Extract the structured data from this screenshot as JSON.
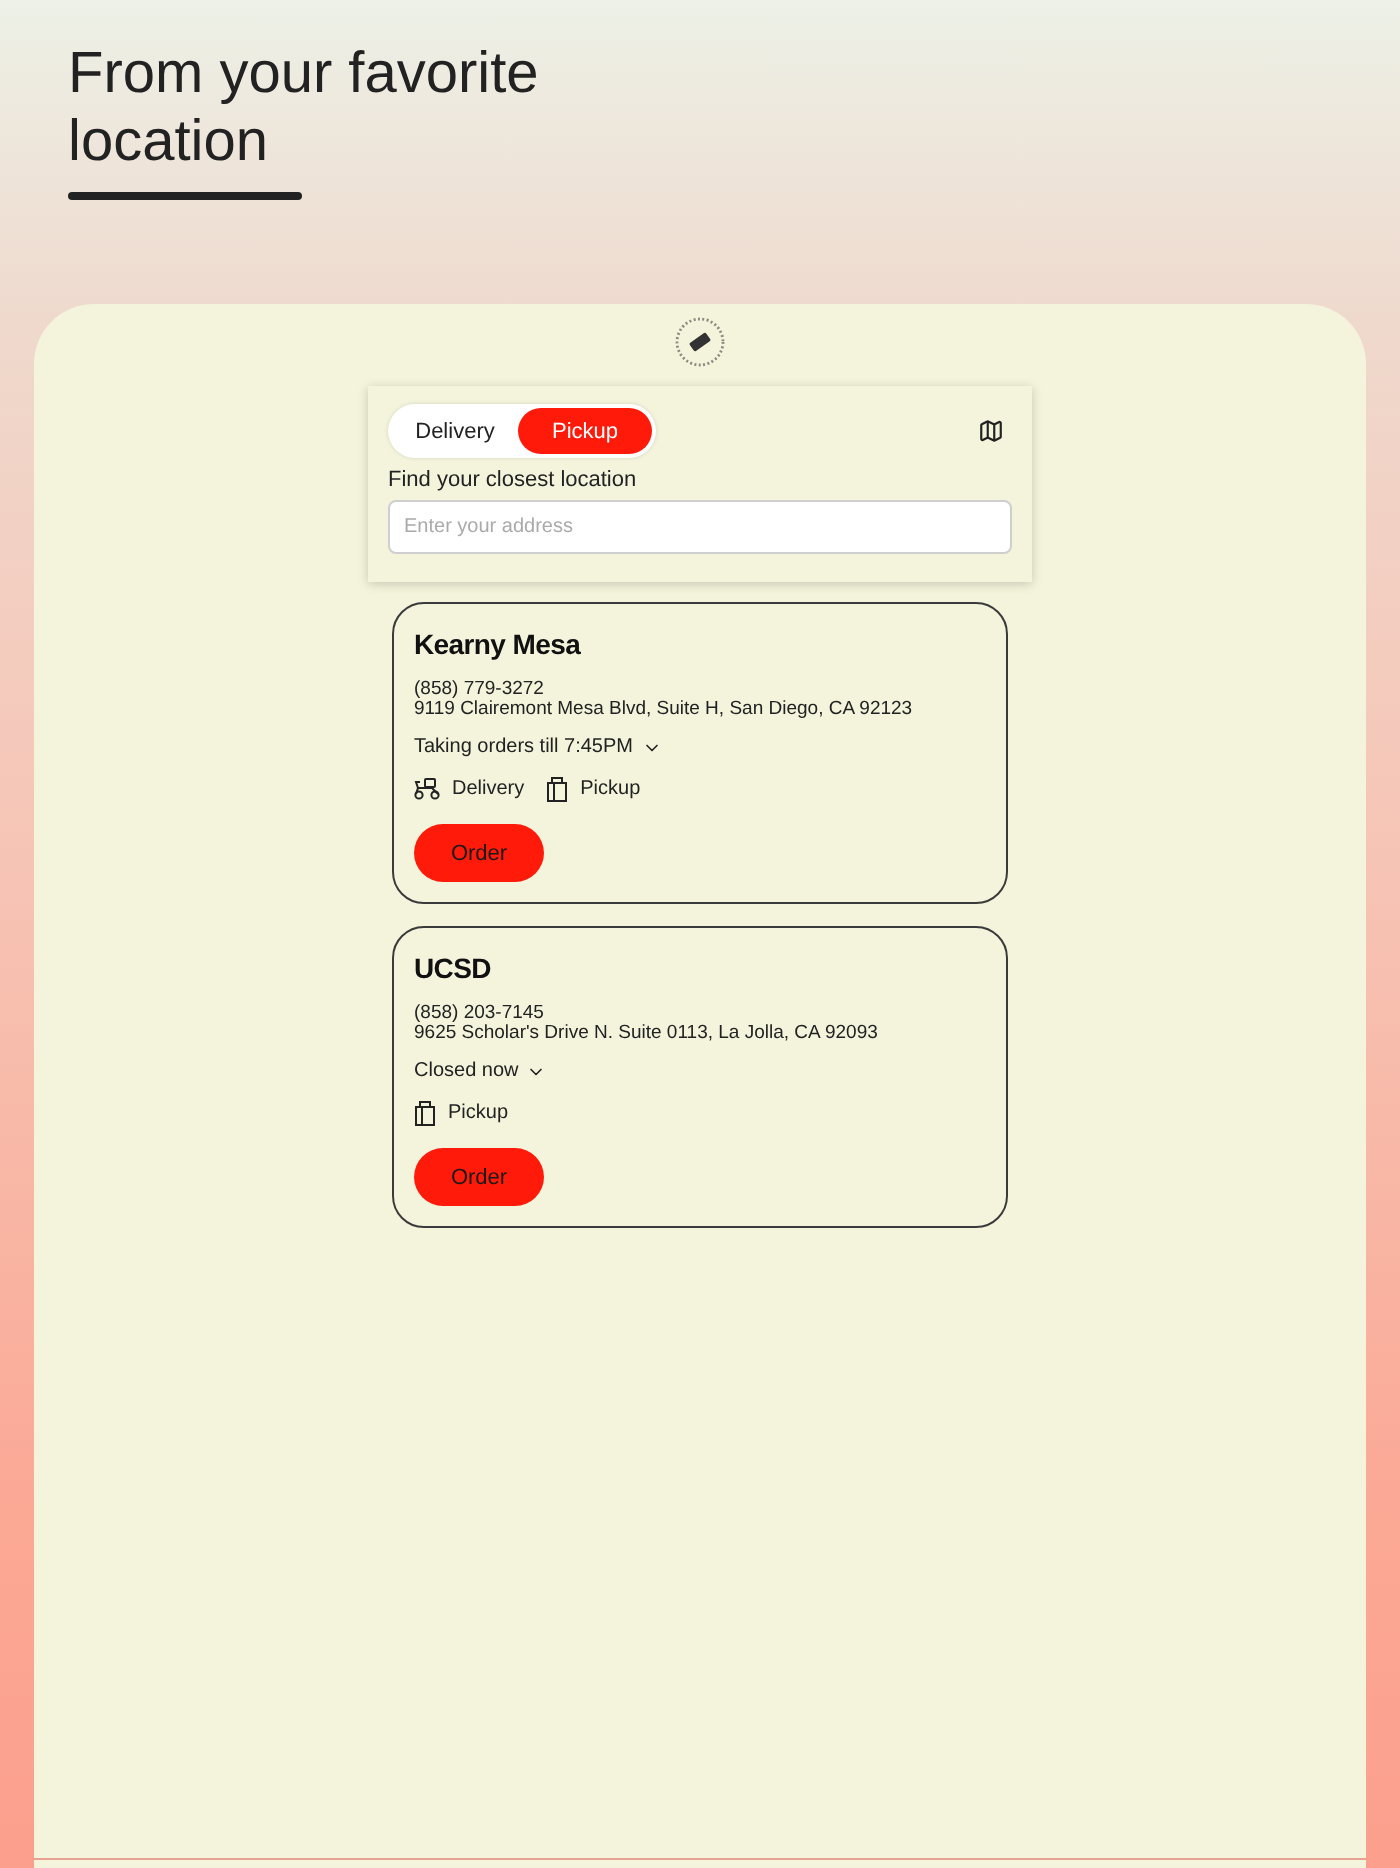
{
  "heading": "From your favorite location",
  "order_mode": [
    {
      "label": "Delivery",
      "selected": false
    },
    {
      "label": "Pickup",
      "selected": true
    }
  ],
  "search": {
    "label": "Find your closest location",
    "placeholder": "Enter your address"
  },
  "locations": [
    {
      "name": "Kearny Mesa",
      "phone": "(858) 779-3272",
      "address": "9119 Clairemont Mesa Blvd, Suite H, San Diego, CA 92123",
      "hours": "Taking orders till 7:45PM",
      "services": [
        {
          "kind": "delivery",
          "label": "Delivery"
        },
        {
          "kind": "pickup",
          "label": "Pickup"
        }
      ],
      "button": "Order"
    },
    {
      "name": "UCSD",
      "phone": "(858) 203-7145",
      "address": "9625 Scholar's Drive N. Suite 0113, La Jolla, CA 92093",
      "hours": "Closed now",
      "services": [
        {
          "kind": "pickup",
          "label": "Pickup"
        }
      ],
      "button": "Order"
    }
  ]
}
